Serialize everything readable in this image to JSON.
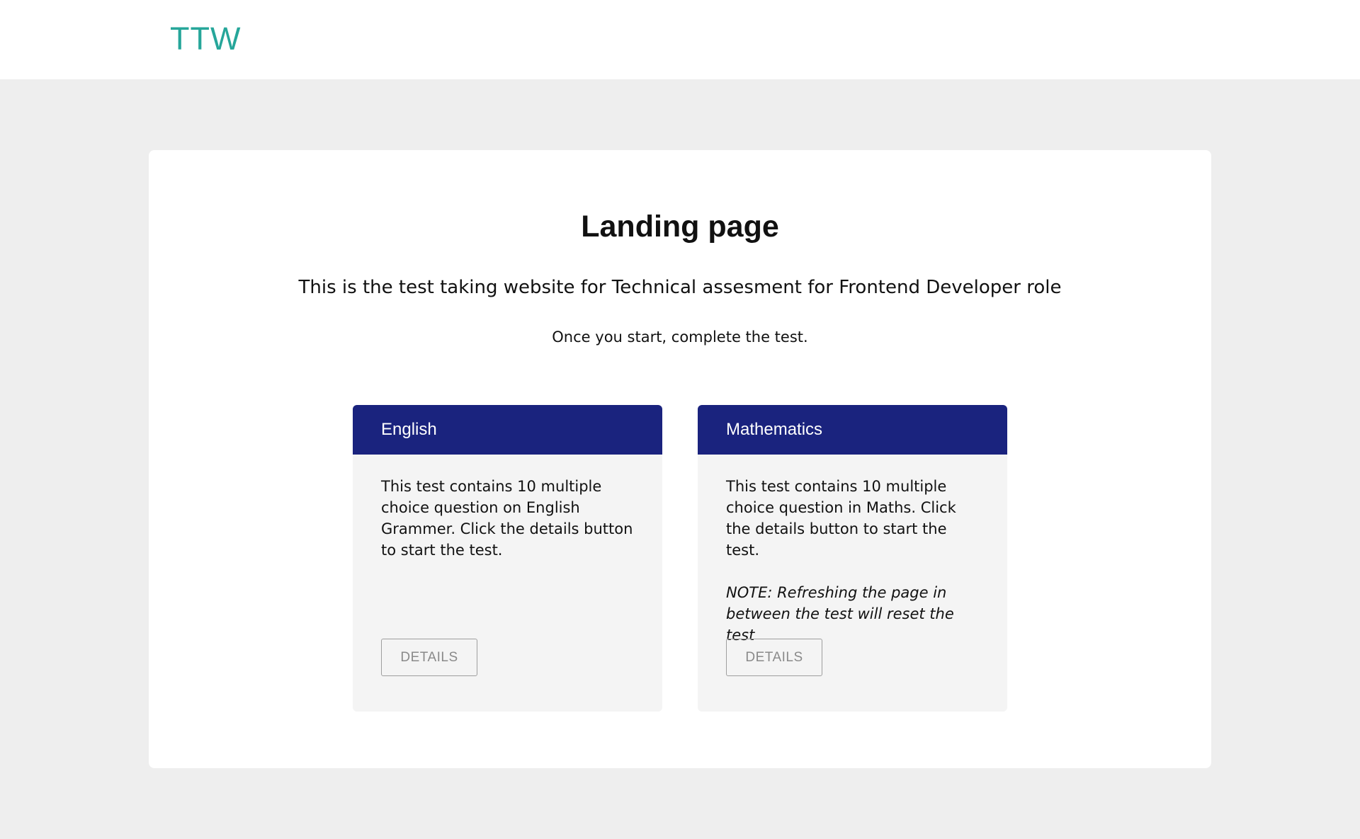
{
  "header": {
    "brand": "TTW",
    "brand_color": "#26a69a"
  },
  "main": {
    "title": "Landing page",
    "subtitle": "This is the test taking website for Technical assesment for Frontend Developer role",
    "instruction": "Once you start, complete the test."
  },
  "cards": [
    {
      "title": "English",
      "description": "This test contains 10 multiple choice question on English Grammer. Click the details button to start the test.",
      "note": "",
      "button_label": "DETAILS"
    },
    {
      "title": "Mathematics",
      "description": "This test contains 10 multiple choice question in Maths. Click the details button to start the test.",
      "note": "NOTE: Refreshing the page in between the test will reset the test",
      "button_label": "DETAILS"
    }
  ],
  "colors": {
    "card_header": "#1a237e",
    "page_background": "#eeeeee",
    "card_background": "#f4f4f4"
  }
}
